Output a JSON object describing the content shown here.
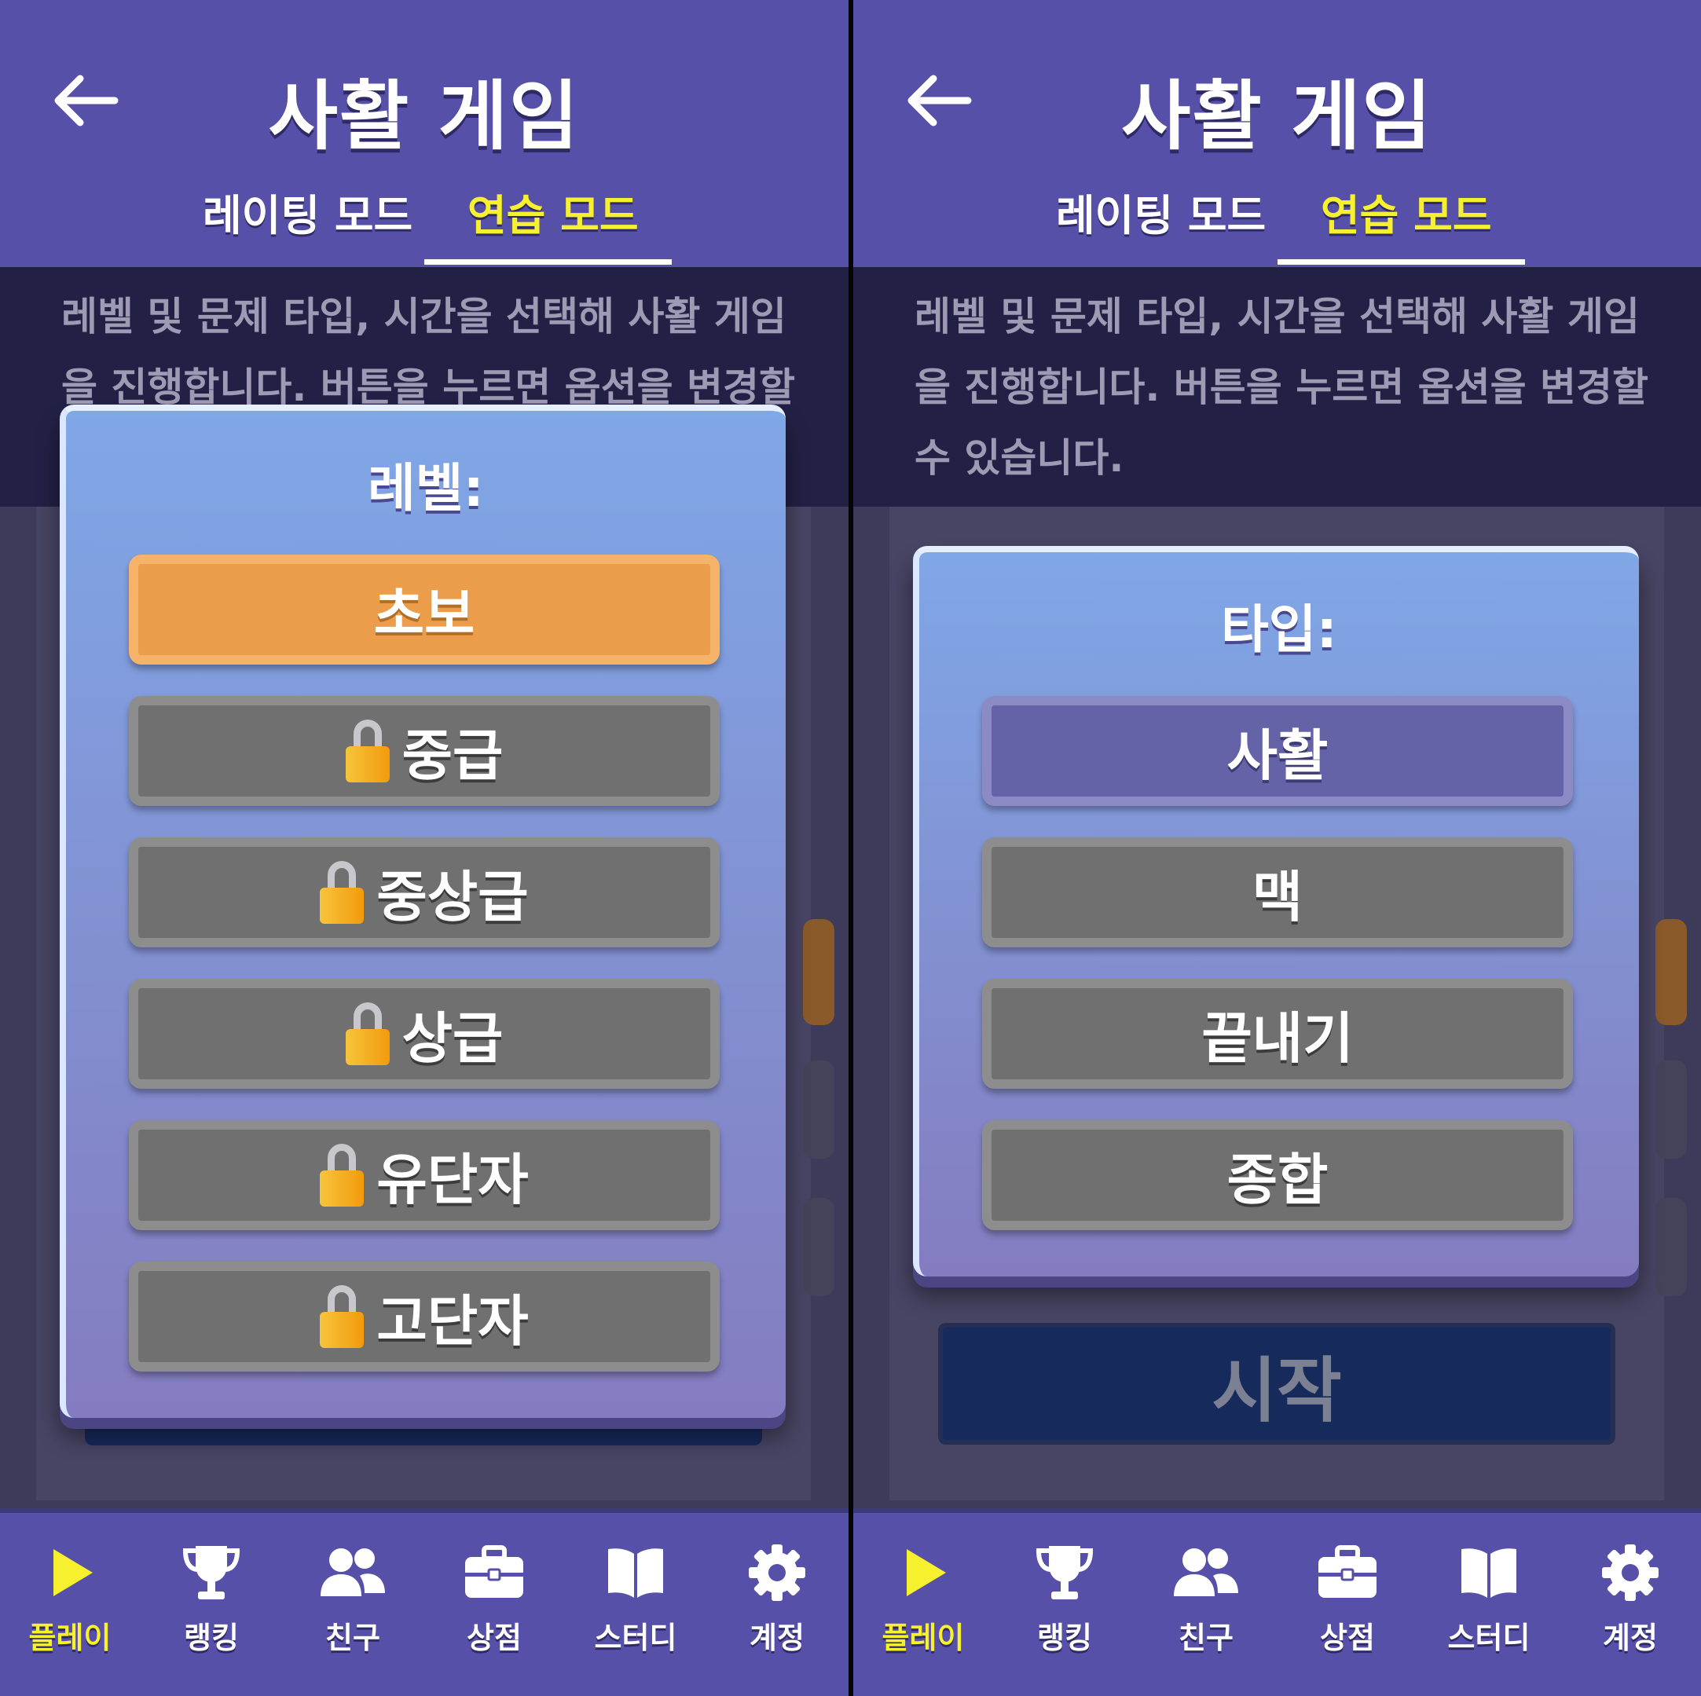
{
  "screens": [
    {
      "header": {
        "title": "사활 게임",
        "tab_rating": "레이팅 모드",
        "tab_practice": "연습 모드",
        "active_tab": "연습 모드"
      },
      "description": "레벨 및 문제 타입, 시간을 선택해 사활 게임을 진행합니다. 버튼을 누르면 옵션을 변경할 수 있습니다.",
      "modal": {
        "label": "레벨:",
        "options": [
          {
            "label": "초보",
            "locked": false,
            "selected": true
          },
          {
            "label": "중급",
            "locked": true,
            "selected": false
          },
          {
            "label": "중상급",
            "locked": true,
            "selected": false
          },
          {
            "label": "상급",
            "locked": true,
            "selected": false
          },
          {
            "label": "유단자",
            "locked": true,
            "selected": false
          },
          {
            "label": "고단자",
            "locked": true,
            "selected": false
          }
        ]
      }
    },
    {
      "header": {
        "title": "사활 게임",
        "tab_rating": "레이팅 모드",
        "tab_practice": "연습 모드",
        "active_tab": "연습 모드"
      },
      "description": "레벨 및 문제 타입, 시간을 선택해 사활 게임을 진행합니다. 버튼을 누르면 옵션을 변경할 수 있습니다.",
      "modal": {
        "label": "타입:",
        "options": [
          {
            "label": "사활",
            "locked": false,
            "selected": true
          },
          {
            "label": "맥",
            "locked": false,
            "selected": false
          },
          {
            "label": "끝내기",
            "locked": false,
            "selected": false
          },
          {
            "label": "종합",
            "locked": false,
            "selected": false
          }
        ]
      },
      "start_button": "시작"
    }
  ],
  "nav": [
    {
      "label": "플레이",
      "icon": "play-icon",
      "active": true
    },
    {
      "label": "랭킹",
      "icon": "trophy-icon",
      "active": false
    },
    {
      "label": "친구",
      "icon": "friends-icon",
      "active": false
    },
    {
      "label": "상점",
      "icon": "shop-icon",
      "active": false
    },
    {
      "label": "스터디",
      "icon": "book-icon",
      "active": false
    },
    {
      "label": "계정",
      "icon": "gear-icon",
      "active": false
    }
  ],
  "colors": {
    "header": "#5750a8",
    "active_tab": "#f7f02f",
    "selected_orange": "#eb9d4b",
    "selected_purple": "#6563a8",
    "option_gray": "#707070",
    "start_button": "#172a5c"
  }
}
